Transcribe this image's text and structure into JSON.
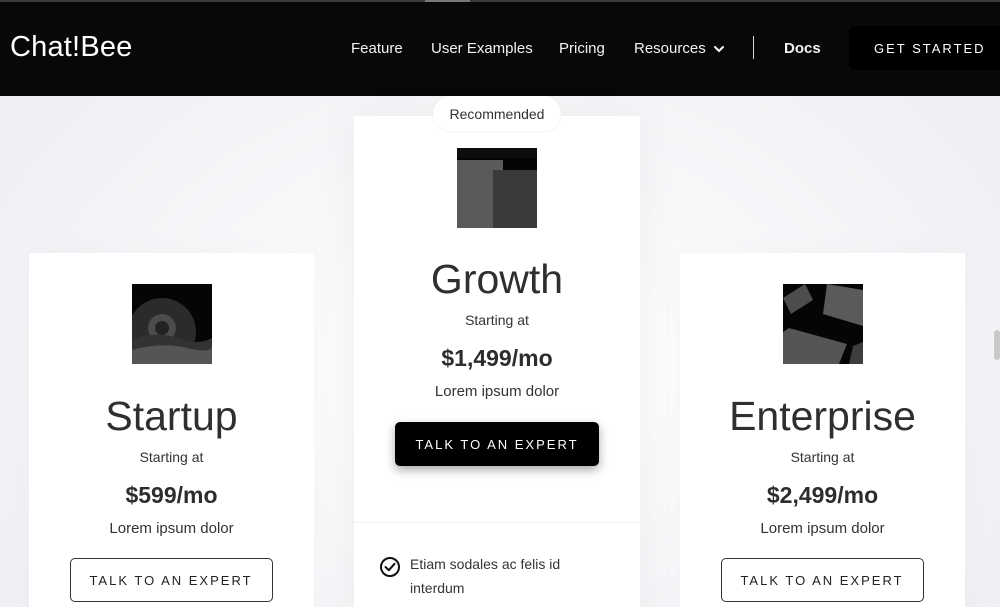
{
  "nav": {
    "logo": "Chat!Bee",
    "links": [
      "Feature",
      "User Examples",
      "Pricing"
    ],
    "resources": "Resources",
    "docs": "Docs",
    "cta": "GET STARTED"
  },
  "plans": [
    {
      "name": "Startup",
      "starting": "Starting at",
      "price": "$599/mo",
      "desc": "Lorem ipsum dolor",
      "button": "TALK TO AN EXPERT",
      "image_icon": "landscape-icon"
    },
    {
      "badge": "Recommended",
      "name": "Growth",
      "starting": "Starting at",
      "price": "$1,499/mo",
      "desc": "Lorem ipsum dolor",
      "button": "TALK TO AN EXPERT",
      "image_icon": "buildings-icon",
      "features": [
        "Etiam sodales ac felis id interdum"
      ]
    },
    {
      "name": "Enterprise",
      "starting": "Starting at",
      "price": "$2,499/mo",
      "desc": "Lorem ipsum dolor",
      "button": "TALK TO AN EXPERT",
      "image_icon": "blocks-icon"
    }
  ],
  "colors": {
    "nav_bg": "#080808",
    "accent": "#000000",
    "text": "#2e2e2e"
  }
}
